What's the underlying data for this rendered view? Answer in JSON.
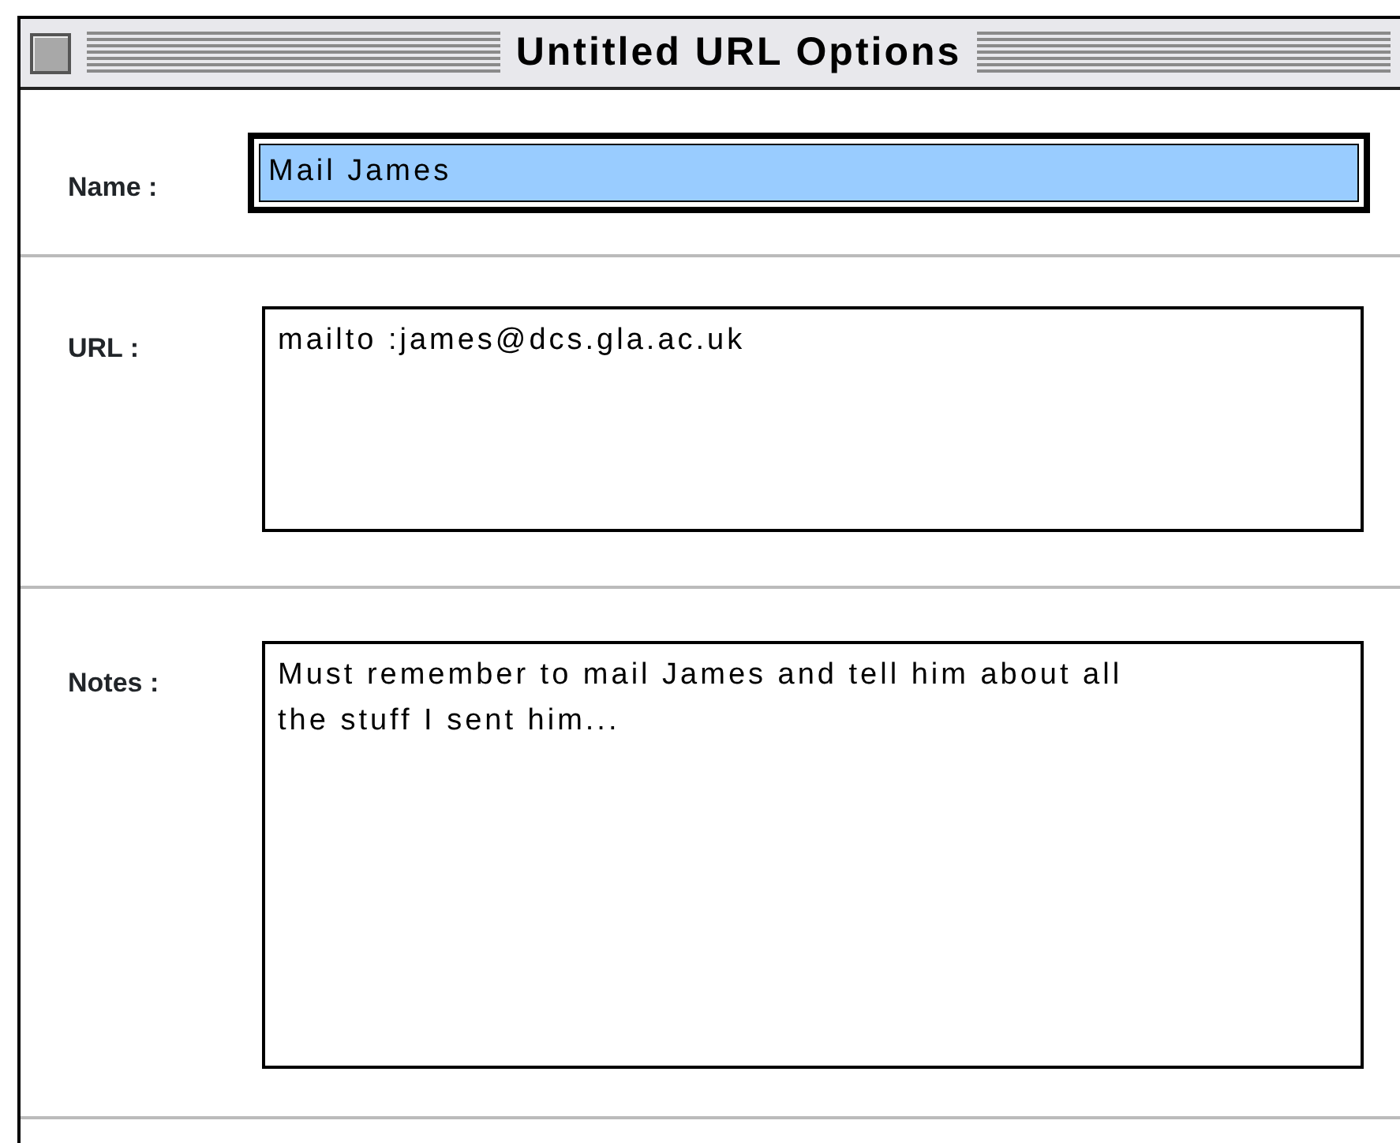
{
  "window": {
    "title": "Untitled URL Options"
  },
  "fields": [
    {
      "label": "Name :",
      "value": "Mail James",
      "focused": true,
      "kind": "line"
    },
    {
      "label": "URL :",
      "value": "mailto :james@dcs.gla.ac.uk",
      "focused": false,
      "kind": "box"
    },
    {
      "label": "Notes :",
      "value": "Must remember to mail James and tell him about all the stuff I sent him...",
      "focused": false,
      "kind": "area"
    }
  ]
}
